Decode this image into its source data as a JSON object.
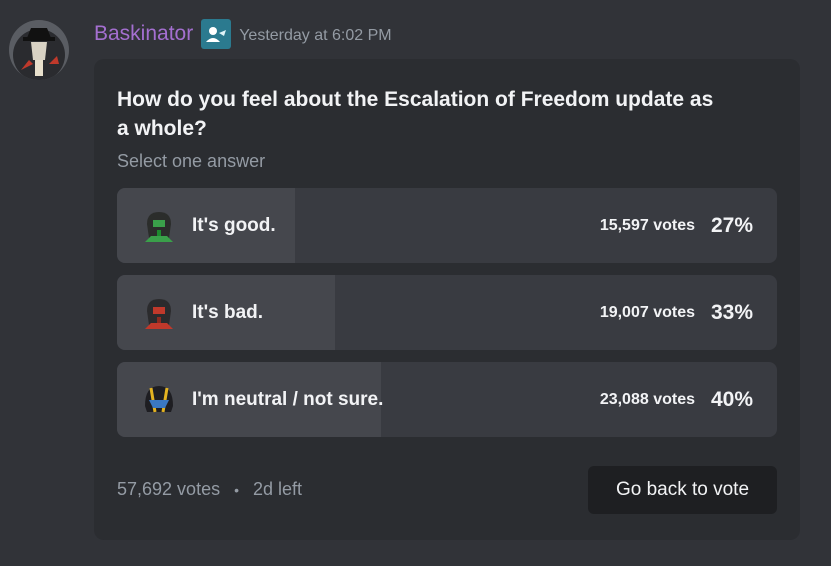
{
  "message": {
    "author": "Baskinator",
    "timestamp": "Yesterday at 6:02 PM",
    "avatar_icon": "helldiver-avatar-icon",
    "role_icon": "role-badge-icon"
  },
  "poll": {
    "question": "How do you feel about the Escalation of Freedom update as a whole?",
    "instructions": "Select one answer",
    "answers": [
      {
        "label": "It's good.",
        "votes": "15,597 votes",
        "percent": "27%",
        "fraction": 0.27,
        "emoji_color": "#3aa04a"
      },
      {
        "label": "It's bad.",
        "votes": "19,007 votes",
        "percent": "33%",
        "fraction": 0.33,
        "emoji_color": "#c0392b"
      },
      {
        "label": "I'm neutral / not sure.",
        "votes": "23,088 votes",
        "percent": "40%",
        "fraction": 0.4,
        "emoji_color": "#e3b321"
      }
    ],
    "total_votes": "57,692 votes",
    "separator": "•",
    "time_left": "2d left",
    "vote_button": "Go back to vote"
  }
}
